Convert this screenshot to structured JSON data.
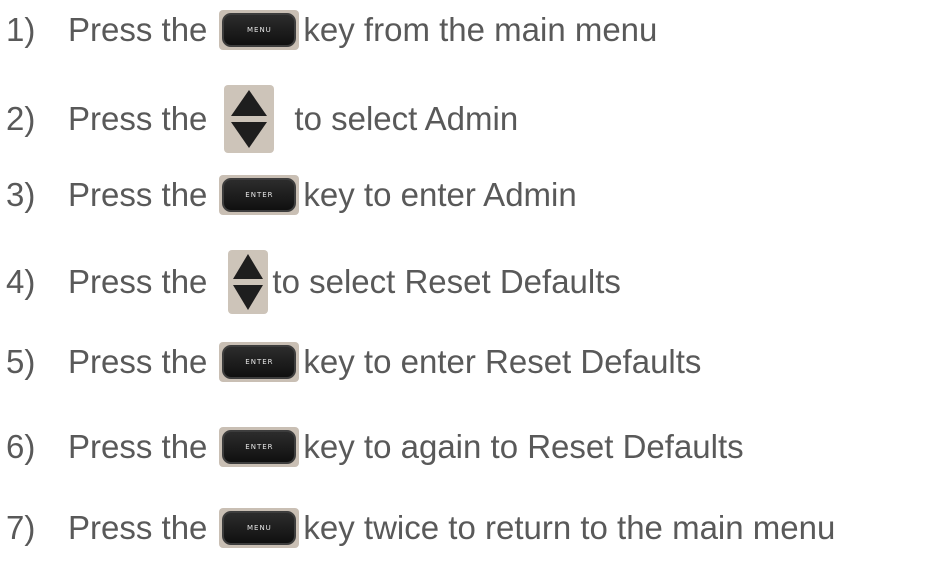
{
  "steps": [
    {
      "number": "1)",
      "prefix": "Press the",
      "key": "MENU",
      "text": "key from the main menu"
    },
    {
      "number": "2)",
      "prefix": "Press the",
      "key": "arrows",
      "text": "to select Admin"
    },
    {
      "number": "3)",
      "prefix": "Press the",
      "key": "ENTER",
      "text": "key to enter Admin"
    },
    {
      "number": "4)",
      "prefix": "Press the",
      "key": "arrows",
      "text": "to select Reset Defaults"
    },
    {
      "number": "5)",
      "prefix": "Press the",
      "key": "ENTER",
      "text": "key to enter Reset Defaults"
    },
    {
      "number": "6)",
      "prefix": "Press the",
      "key": "ENTER",
      "text": "key to again to Reset Defaults"
    },
    {
      "number": "7)",
      "prefix": "Press the",
      "key": "MENU",
      "text": "key twice to return to the main menu"
    }
  ],
  "icons": {
    "menu_key": "menu-key-icon",
    "enter_key": "enter-key-icon",
    "arrows_key": "up-down-arrow-key-icon"
  },
  "colors": {
    "text": "#595959",
    "key_face": "#151515",
    "key_surround": "#c9bfb4",
    "arrow": "#1e1e1e"
  }
}
